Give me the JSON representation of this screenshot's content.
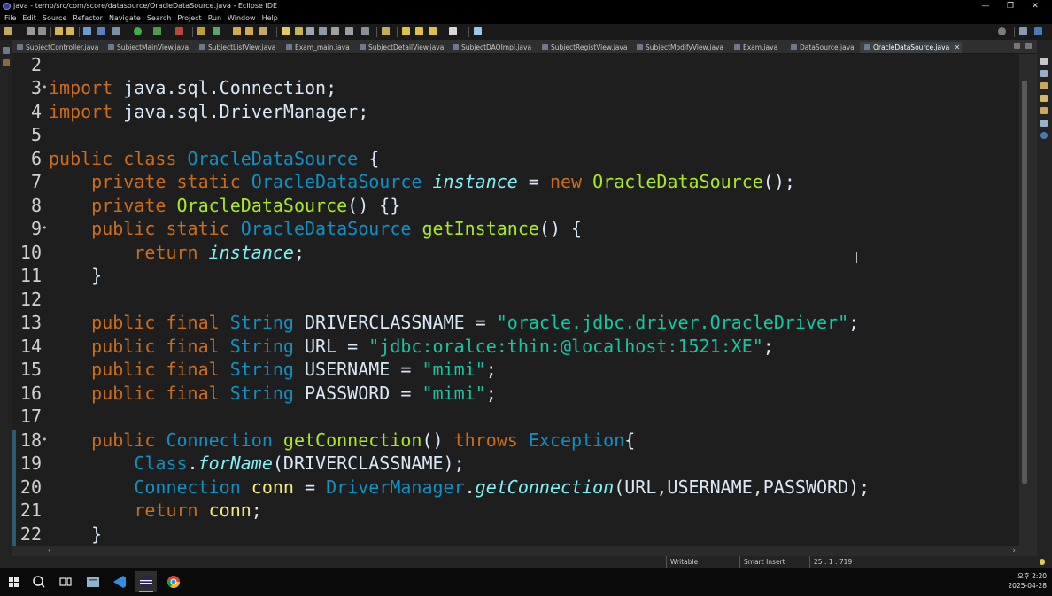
{
  "window": {
    "title": "java - temp/src/com/score/datasource/OracleDataSource.java - Eclipse IDE",
    "minimize": "—",
    "maximize": "❐",
    "close": "✕"
  },
  "menu": [
    "File",
    "Edit",
    "Source",
    "Refactor",
    "Navigate",
    "Search",
    "Project",
    "Run",
    "Window",
    "Help"
  ],
  "tabs": [
    {
      "label": "SubjectController.java"
    },
    {
      "label": "SubjectMainView.java"
    },
    {
      "label": "SubjectListView.java"
    },
    {
      "label": "Exam_main.java"
    },
    {
      "label": "SubjectDetailView.java"
    },
    {
      "label": "SubjectDAOImpl.java"
    },
    {
      "label": "SubjectRegistView.java"
    },
    {
      "label": "SubjectModifyView.java"
    },
    {
      "label": "Exam.java"
    },
    {
      "label": "DataSource.java"
    },
    {
      "label": "OracleDataSource.java",
      "active": true,
      "close": "✕"
    }
  ],
  "editor": {
    "lines": [
      {
        "n": "2",
        "fold": "",
        "parts": []
      },
      {
        "n": "3",
        "fold": "•",
        "parts": [
          [
            "kw",
            "import "
          ],
          [
            "df",
            "java.sql.Connection;"
          ]
        ]
      },
      {
        "n": "4",
        "fold": "",
        "parts": [
          [
            "kw",
            "import "
          ],
          [
            "df",
            "java.sql.DriverManager;"
          ]
        ]
      },
      {
        "n": "5",
        "fold": "",
        "parts": []
      },
      {
        "n": "6",
        "fold": "",
        "parts": [
          [
            "kw",
            "public class "
          ],
          [
            "ty",
            "OracleDataSource"
          ],
          [
            "df",
            " {"
          ]
        ]
      },
      {
        "n": "7",
        "fold": "",
        "parts": [
          [
            "df",
            "    "
          ],
          [
            "kw",
            "private static "
          ],
          [
            "ty",
            "OracleDataSource "
          ],
          [
            "it",
            "instance"
          ],
          [
            "df",
            " = "
          ],
          [
            "kw",
            "new "
          ],
          [
            "fn",
            "OracleDataSource"
          ],
          [
            "df",
            "();"
          ]
        ]
      },
      {
        "n": "8",
        "fold": "",
        "parts": [
          [
            "df",
            "    "
          ],
          [
            "kw",
            "private "
          ],
          [
            "fn",
            "OracleDataSource"
          ],
          [
            "df",
            "() {}"
          ]
        ]
      },
      {
        "n": "9",
        "fold": "•",
        "parts": [
          [
            "df",
            "    "
          ],
          [
            "kw",
            "public static "
          ],
          [
            "ty",
            "OracleDataSource "
          ],
          [
            "fn",
            "getInstance"
          ],
          [
            "df",
            "() {"
          ]
        ]
      },
      {
        "n": "10",
        "fold": "",
        "parts": [
          [
            "df",
            "        "
          ],
          [
            "kw",
            "return "
          ],
          [
            "it",
            "instance"
          ],
          [
            "df",
            ";"
          ]
        ]
      },
      {
        "n": "11",
        "fold": "",
        "parts": [
          [
            "df",
            "    }"
          ]
        ]
      },
      {
        "n": "12",
        "fold": "",
        "parts": []
      },
      {
        "n": "13",
        "fold": "",
        "parts": [
          [
            "df",
            "    "
          ],
          [
            "kw",
            "public final "
          ],
          [
            "ty",
            "String "
          ],
          [
            "df",
            "DRIVERCLASSNAME = "
          ],
          [
            "st",
            "\"oracle.jdbc.driver.OracleDriver\""
          ],
          [
            "df",
            ";"
          ]
        ]
      },
      {
        "n": "14",
        "fold": "",
        "parts": [
          [
            "df",
            "    "
          ],
          [
            "kw",
            "public final "
          ],
          [
            "ty",
            "String "
          ],
          [
            "df",
            "URL = "
          ],
          [
            "st",
            "\"jdbc:oralce:thin:@localhost:1521:XE\""
          ],
          [
            "df",
            ";"
          ]
        ]
      },
      {
        "n": "15",
        "fold": "",
        "parts": [
          [
            "df",
            "    "
          ],
          [
            "kw",
            "public final "
          ],
          [
            "ty",
            "String "
          ],
          [
            "df",
            "USERNAME = "
          ],
          [
            "st",
            "\"mimi\""
          ],
          [
            "df",
            ";"
          ]
        ]
      },
      {
        "n": "16",
        "fold": "",
        "parts": [
          [
            "df",
            "    "
          ],
          [
            "kw",
            "public final "
          ],
          [
            "ty",
            "String "
          ],
          [
            "df",
            "PASSWORD = "
          ],
          [
            "st",
            "\"mimi\""
          ],
          [
            "df",
            ";"
          ]
        ]
      },
      {
        "n": "17",
        "fold": "",
        "parts": []
      },
      {
        "n": "18",
        "fold": "•",
        "parts": [
          [
            "df",
            "    "
          ],
          [
            "kw",
            "public "
          ],
          [
            "ty",
            "Connection "
          ],
          [
            "fn",
            "getConnection"
          ],
          [
            "df",
            "() "
          ],
          [
            "kw",
            "throws "
          ],
          [
            "ty",
            "Exception"
          ],
          [
            "df",
            "{"
          ]
        ]
      },
      {
        "n": "19",
        "fold": "",
        "parts": [
          [
            "df",
            "        "
          ],
          [
            "ty",
            "Class"
          ],
          [
            "df",
            "."
          ],
          [
            "it",
            "forName"
          ],
          [
            "df",
            "(DRIVERCLASSNAME);"
          ]
        ]
      },
      {
        "n": "20",
        "fold": "",
        "parts": [
          [
            "df",
            "        "
          ],
          [
            "ty",
            "Connection "
          ],
          [
            "vr",
            "conn"
          ],
          [
            "df",
            " = "
          ],
          [
            "ty",
            "DriverManager"
          ],
          [
            "df",
            "."
          ],
          [
            "it",
            "getConnection"
          ],
          [
            "df",
            "(URL,USERNAME,PASSWORD);"
          ]
        ]
      },
      {
        "n": "21",
        "fold": "",
        "parts": [
          [
            "df",
            "        "
          ],
          [
            "kw",
            "return "
          ],
          [
            "vr",
            "conn"
          ],
          [
            "df",
            ";"
          ]
        ]
      },
      {
        "n": "22",
        "fold": "",
        "parts": [
          [
            "df",
            "    }"
          ]
        ]
      }
    ]
  },
  "status": {
    "writable": "Writable",
    "insert_mode": "Smart Insert",
    "position": "25 : 1 : 719"
  },
  "taskbar": {
    "time": "오후 2:20",
    "date": "2025-04-28"
  },
  "colors": {
    "keyword": "#cc6c1d",
    "type": "#1290c3",
    "method": "#a7ec21",
    "italic_field": "#80f2f6",
    "string": "#17c6a3",
    "local_var": "#f3ec79",
    "default_text": "#d9e8f7"
  }
}
